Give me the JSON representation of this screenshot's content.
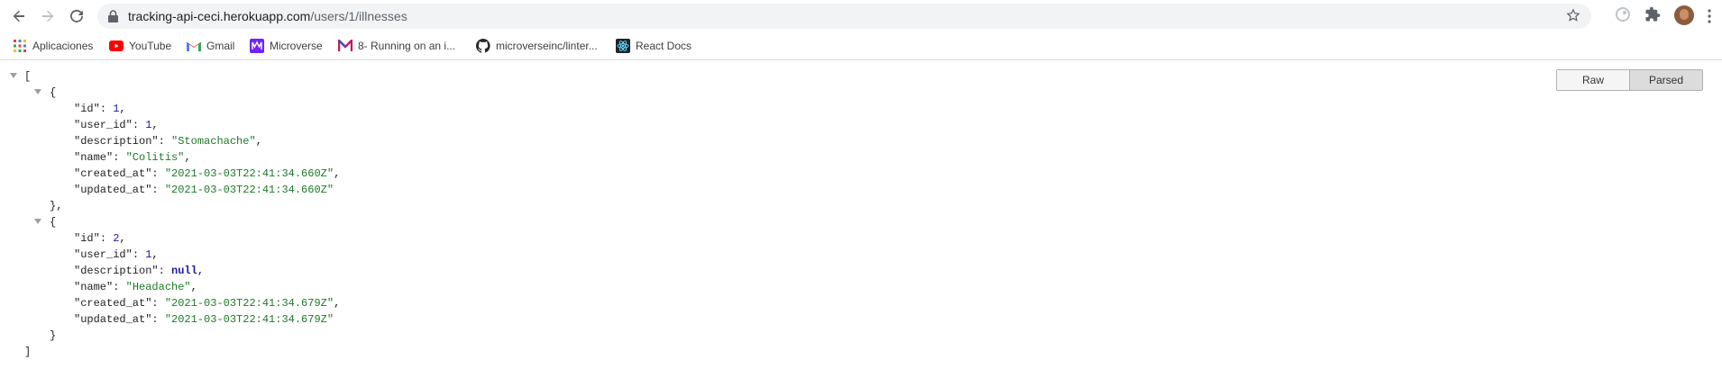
{
  "address": {
    "host": "tracking-api-ceci.herokuapp.com",
    "path": "/users/1/illnesses"
  },
  "bookmarks": [
    {
      "label": "Aplicaciones",
      "icon": "apps-grid-icon"
    },
    {
      "label": "YouTube",
      "icon": "youtube-icon"
    },
    {
      "label": "Gmail",
      "icon": "gmail-icon"
    },
    {
      "label": "Microverse",
      "icon": "microverse-icon"
    },
    {
      "label": "8- Running on an i...",
      "icon": "m-logo-icon"
    },
    {
      "label": "microverseinc/linter...",
      "icon": "github-icon"
    },
    {
      "label": "React Docs",
      "icon": "react-icon"
    }
  ],
  "viewer_toggle": {
    "raw": "Raw",
    "parsed": "Parsed",
    "selected": "Parsed"
  },
  "json": {
    "open_bracket": "[",
    "close_bracket": "]",
    "open_brace": "{",
    "close_brace_comma": "},",
    "close_brace": "}",
    "items": [
      {
        "id_key": "\"id\"",
        "id_val": "1",
        "user_id_key": "\"user_id\"",
        "user_id_val": "1",
        "description_key": "\"description\"",
        "description_val": "\"Stomachache\"",
        "name_key": "\"name\"",
        "name_val": "\"Colitis\"",
        "created_at_key": "\"created_at\"",
        "created_at_val": "\"2021-03-03T22:41:34.660Z\"",
        "updated_at_key": "\"updated_at\"",
        "updated_at_val": "\"2021-03-03T22:41:34.660Z\""
      },
      {
        "id_key": "\"id\"",
        "id_val": "2",
        "user_id_key": "\"user_id\"",
        "user_id_val": "1",
        "description_key": "\"description\"",
        "description_val": "null",
        "name_key": "\"name\"",
        "name_val": "\"Headache\"",
        "created_at_key": "\"created_at\"",
        "created_at_val": "\"2021-03-03T22:41:34.679Z\"",
        "updated_at_key": "\"updated_at\"",
        "updated_at_val": "\"2021-03-03T22:41:34.679Z\""
      }
    ]
  }
}
